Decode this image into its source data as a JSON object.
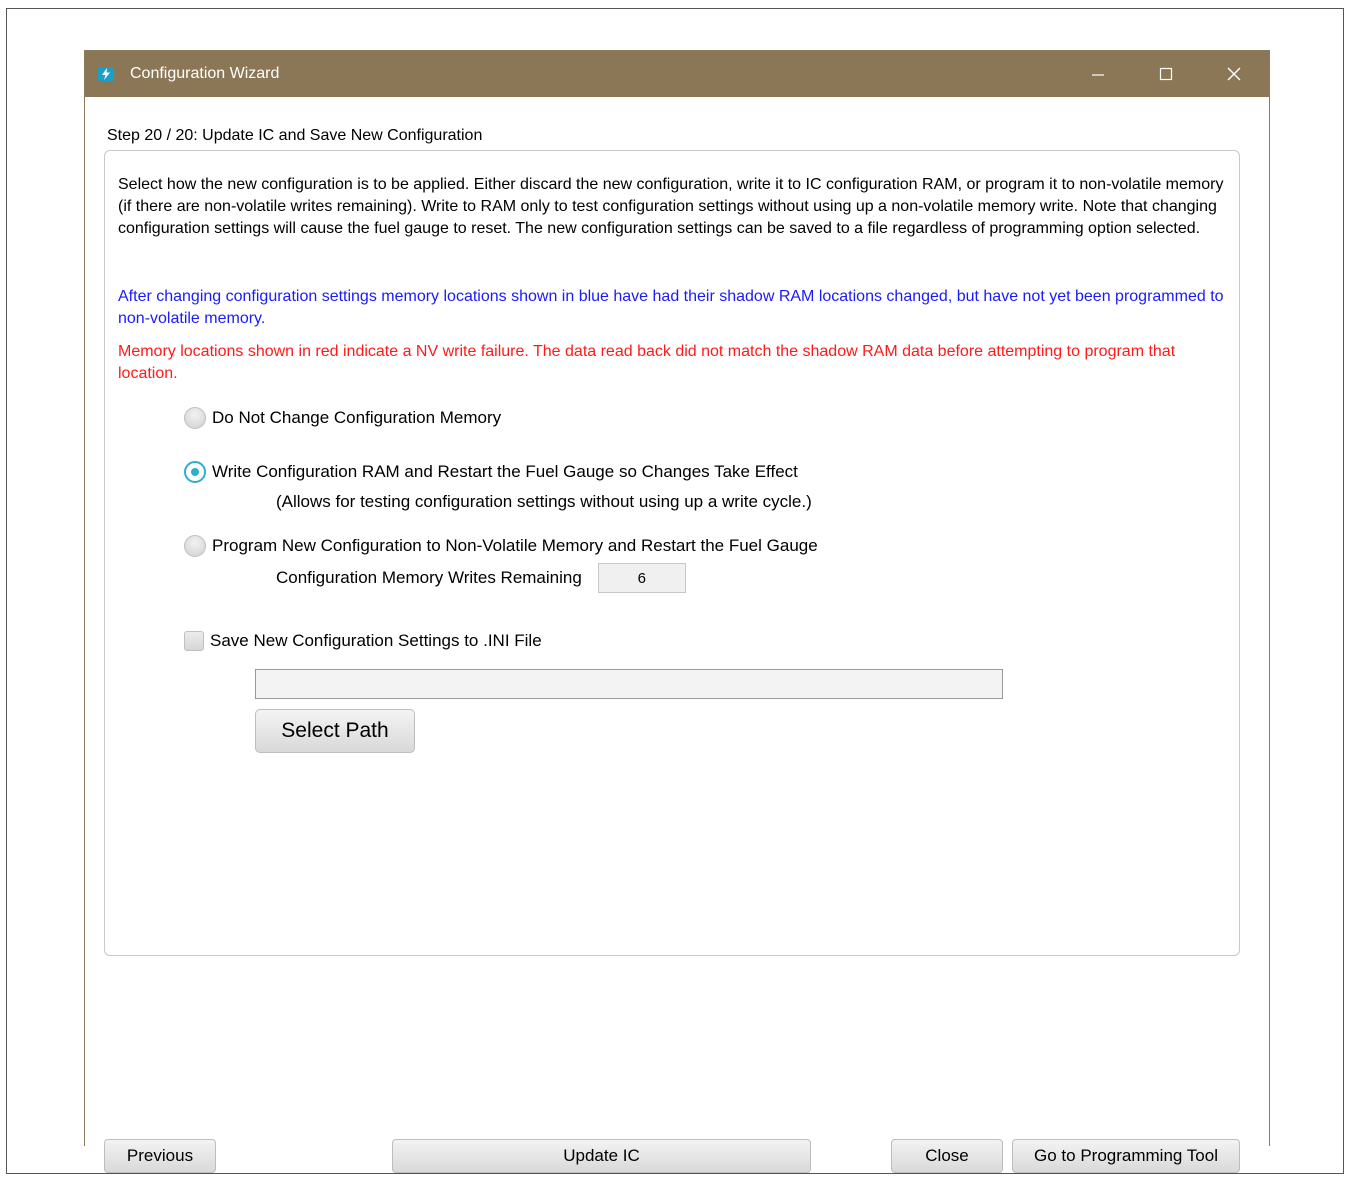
{
  "window": {
    "title": "Configuration Wizard",
    "title_bar_color": "#8b7656"
  },
  "step": {
    "label": "Step 20 / 20: Update IC and Save New Configuration"
  },
  "info": {
    "description": "Select how the new configuration is to be applied. Either discard the new configuration, write it to IC configuration RAM, or program it to non-volatile memory (if there are non-volatile writes remaining). Write to RAM only to test configuration settings without using up a non-volatile memory write. Note that changing configuration settings will cause the fuel gauge to reset. The new configuration settings can be saved to a file regardless of programming option selected.",
    "blue_note": "After changing configuration settings memory locations shown in blue have had their shadow RAM locations changed, but have not yet been programmed to non-volatile memory.",
    "red_note": "Memory locations shown in red indicate a NV write failure. The data read back did not match the shadow RAM data before attempting to program that location.",
    "blue_color": "#1a1aff",
    "red_color": "#ff1a1a"
  },
  "options": {
    "no_change": {
      "label": "Do Not Change Configuration Memory",
      "selected": false
    },
    "write_ram": {
      "label": "Write Configuration RAM and Restart the Fuel Gauge so Changes Take Effect",
      "selected": true,
      "note": "(Allows for testing configuration settings without using up a write cycle.)"
    },
    "program_nv": {
      "label": "Program New Configuration to Non-Volatile Memory and Restart the Fuel Gauge",
      "selected": false
    },
    "writes_remaining_label": "Configuration Memory Writes Remaining",
    "writes_remaining_value": "6"
  },
  "save": {
    "checkbox_label": "Save New Configuration Settings to .INI File",
    "checked": false,
    "path_value": "",
    "select_path_label": "Select Path"
  },
  "footer": {
    "previous": "Previous",
    "update_ic": "Update IC",
    "close": "Close",
    "goto_programming": "Go to Programming Tool"
  }
}
